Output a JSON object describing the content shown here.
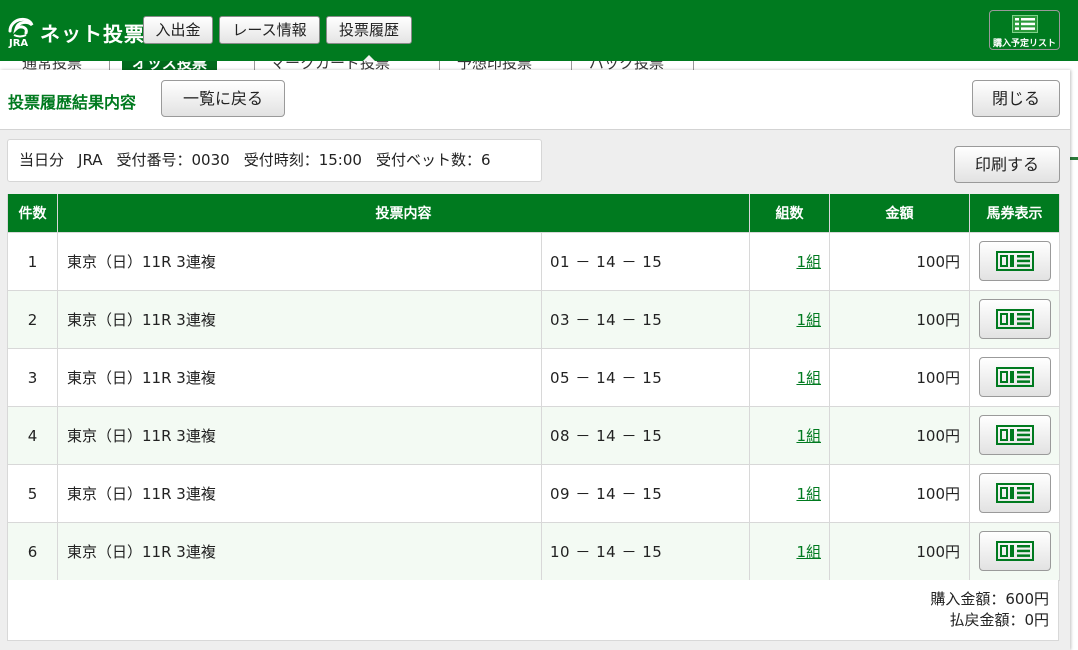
{
  "header": {
    "logo_small": "JRA",
    "logo_text": "ネット投票",
    "nav": [
      "入出金",
      "レース情報",
      "投票履歴"
    ],
    "cart_label": "購入予定リスト"
  },
  "bg_tabs": [
    "通常投票",
    "オッズ投票",
    "マークカード投票",
    "予想印投票",
    "パック投票"
  ],
  "modal": {
    "title": "投票履歴結果内容",
    "back_label": "一覧に戻る",
    "close_label": "閉じる",
    "print_label": "印刷する"
  },
  "info": {
    "day": "当日分",
    "org": "JRA",
    "receipt_no": "受付番号：0030",
    "receipt_time": "受付時刻：15:00",
    "bet_count": "受付ベット数：6"
  },
  "table": {
    "headers": [
      "件数",
      "投票内容",
      "組数",
      "金額",
      "馬券表示"
    ],
    "rows": [
      {
        "no": "1",
        "race": "東京（日）11R  3連複",
        "combo": "01 － 14 － 15",
        "kumi": "1組",
        "amount": "100円"
      },
      {
        "no": "2",
        "race": "東京（日）11R  3連複",
        "combo": "03 － 14 － 15",
        "kumi": "1組",
        "amount": "100円"
      },
      {
        "no": "3",
        "race": "東京（日）11R  3連複",
        "combo": "05 － 14 － 15",
        "kumi": "1組",
        "amount": "100円"
      },
      {
        "no": "4",
        "race": "東京（日）11R  3連複",
        "combo": "08 － 14 － 15",
        "kumi": "1組",
        "amount": "100円"
      },
      {
        "no": "5",
        "race": "東京（日）11R  3連複",
        "combo": "09 － 14 － 15",
        "kumi": "1組",
        "amount": "100円"
      },
      {
        "no": "6",
        "race": "東京（日）11R  3連複",
        "combo": "10 － 14 － 15",
        "kumi": "1組",
        "amount": "100円"
      }
    ]
  },
  "summary": {
    "purchase": "購入金額：600円",
    "refund": "払戻金額：0円"
  },
  "colors": {
    "brand_green": "#007a1f",
    "row_alt": "#f3faf3"
  },
  "icons": {
    "ticket": "ticket-icon",
    "cart": "list-icon",
    "logo": "jra-logo-icon"
  }
}
